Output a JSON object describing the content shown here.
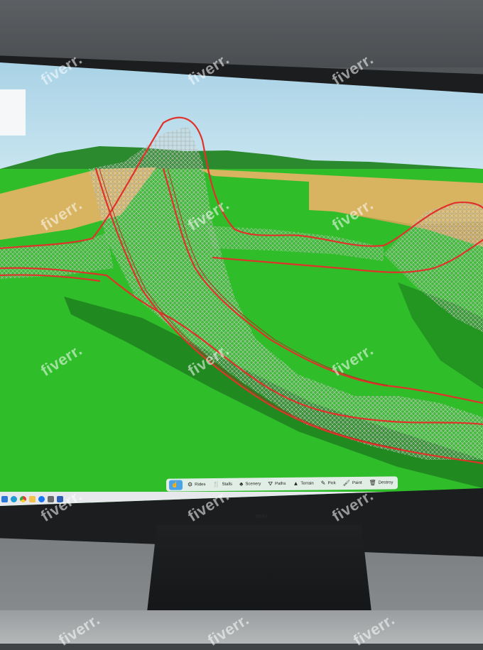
{
  "toolbar": {
    "items": [
      {
        "label": "",
        "icon": "pointer-icon",
        "active": true
      },
      {
        "label": "Rides",
        "icon": "ride-icon"
      },
      {
        "label": "Stalls",
        "icon": "stall-icon"
      },
      {
        "label": "Scenery",
        "icon": "tree-icon"
      },
      {
        "label": "Paths",
        "icon": "path-icon"
      },
      {
        "label": "Terrain",
        "icon": "terrain-icon"
      },
      {
        "label": "Pick",
        "icon": "picker-icon"
      },
      {
        "label": "Paint",
        "icon": "brush-icon"
      },
      {
        "label": "Destroy",
        "icon": "trash-icon"
      }
    ]
  },
  "taskbar": {
    "icons": [
      "start-icon",
      "edge-icon",
      "chrome-icon",
      "folder-icon",
      "facebook-icon",
      "app-icon",
      "blue-app-icon"
    ]
  },
  "watermark": "fiverr.",
  "brand": "msi",
  "colors": {
    "sky": "#b9dcec",
    "grass": "#2fbd2a",
    "sand": "#d8b360",
    "track": "#e0322a",
    "wood": "#d9dad6"
  }
}
